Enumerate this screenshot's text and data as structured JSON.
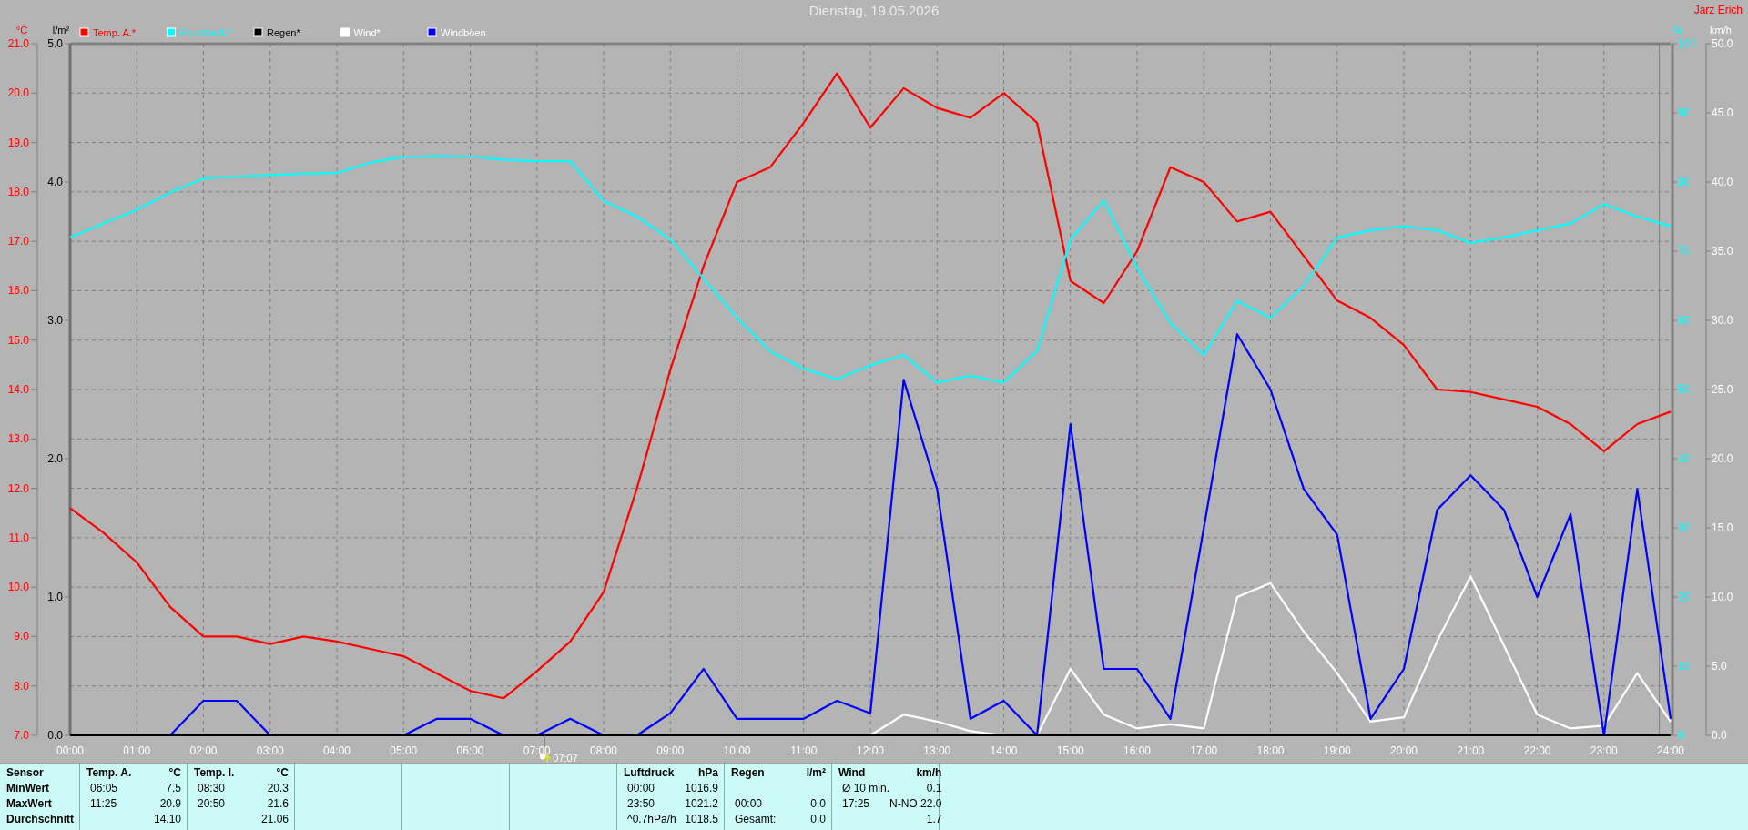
{
  "author": "Jarz Erich",
  "chart_data": {
    "type": "line",
    "title": "Dienstag, 19.05.2026",
    "x": [
      0,
      0.5,
      1,
      1.5,
      2,
      2.5,
      3,
      3.5,
      4,
      4.5,
      5,
      5.5,
      6,
      6.5,
      7,
      7.5,
      8,
      8.5,
      9,
      9.5,
      10,
      10.5,
      11,
      11.5,
      12,
      12.5,
      13,
      13.5,
      14,
      14.5,
      15,
      15.5,
      16,
      16.5,
      17,
      17.5,
      18,
      18.5,
      19,
      19.5,
      20,
      20.5,
      21,
      21.5,
      22,
      22.5,
      23,
      23.5,
      24
    ],
    "xlim": [
      0,
      24
    ],
    "xticks": [
      {
        "value": 0,
        "label": "00:00"
      },
      {
        "value": 1,
        "label": "01:00"
      },
      {
        "value": 2,
        "label": "02:00"
      },
      {
        "value": 3,
        "label": "03:00"
      },
      {
        "value": 4,
        "label": "04:00"
      },
      {
        "value": 5,
        "label": "05:00"
      },
      {
        "value": 6,
        "label": "06:00"
      },
      {
        "value": 7,
        "label": "07:00"
      },
      {
        "value": 8,
        "label": "08:00"
      },
      {
        "value": 9,
        "label": "09:00"
      },
      {
        "value": 10,
        "label": "10:00"
      },
      {
        "value": 11,
        "label": "11:00"
      },
      {
        "value": 12,
        "label": "12:00"
      },
      {
        "value": 13,
        "label": "13:00"
      },
      {
        "value": 14,
        "label": "14:00"
      },
      {
        "value": 15,
        "label": "15:00"
      },
      {
        "value": 16,
        "label": "16:00"
      },
      {
        "value": 17,
        "label": "17:00"
      },
      {
        "value": 18,
        "label": "18:00"
      },
      {
        "value": 19,
        "label": "19:00"
      },
      {
        "value": 20,
        "label": "20:00"
      },
      {
        "value": 21,
        "label": "21:00"
      },
      {
        "value": 22,
        "label": "22:00"
      },
      {
        "value": 23,
        "label": "23:00"
      },
      {
        "value": 24,
        "label": "24:00"
      }
    ],
    "ylabel": "°C",
    "ylim": [
      7,
      21
    ],
    "yticks": [
      {
        "value": 7,
        "label": "7.0"
      },
      {
        "value": 8,
        "label": "8.0"
      },
      {
        "value": 9,
        "label": "9.0"
      },
      {
        "value": 10,
        "label": "10.0"
      },
      {
        "value": 11,
        "label": "11.0"
      },
      {
        "value": 12,
        "label": "12.0"
      },
      {
        "value": 13,
        "label": "13.0"
      },
      {
        "value": 14,
        "label": "14.0"
      },
      {
        "value": 15,
        "label": "15.0"
      },
      {
        "value": 16,
        "label": "16.0"
      },
      {
        "value": 17,
        "label": "17.0"
      },
      {
        "value": 18,
        "label": "18.0"
      },
      {
        "value": 19,
        "label": "19.0"
      },
      {
        "value": 20,
        "label": "20.0"
      },
      {
        "value": 21,
        "label": "21.0"
      }
    ],
    "y2label": "%",
    "y2lim": [
      0,
      100
    ],
    "y2ticks": [
      {
        "value": 0,
        "label": "0"
      },
      {
        "value": 10,
        "label": "10"
      },
      {
        "value": 20,
        "label": "20"
      },
      {
        "value": 30,
        "label": "30"
      },
      {
        "value": 40,
        "label": "40"
      },
      {
        "value": 50,
        "label": "50"
      },
      {
        "value": 60,
        "label": "60"
      },
      {
        "value": 70,
        "label": "70"
      },
      {
        "value": 80,
        "label": "80"
      },
      {
        "value": 90,
        "label": "90"
      },
      {
        "value": 100,
        "label": "100"
      }
    ],
    "y3label": "km/h",
    "y3lim": [
      0,
      50
    ],
    "y3ticks": [
      {
        "value": 0,
        "label": "0.0"
      },
      {
        "value": 5,
        "label": "5.0"
      },
      {
        "value": 10,
        "label": "10.0"
      },
      {
        "value": 15,
        "label": "15.0"
      },
      {
        "value": 20,
        "label": "20.0"
      },
      {
        "value": 25,
        "label": "25.0"
      },
      {
        "value": 30,
        "label": "30.0"
      },
      {
        "value": 35,
        "label": "35.0"
      },
      {
        "value": 40,
        "label": "40.0"
      },
      {
        "value": 45,
        "label": "45.0"
      },
      {
        "value": 50,
        "label": "50.0"
      }
    ],
    "series": [
      {
        "name": "Temp. A.*",
        "color": "#ff0000",
        "values": [
          11.6,
          11.1,
          10.5,
          9.6,
          9.0,
          9.0,
          8.85,
          9.0,
          8.9,
          8.75,
          8.6,
          8.25,
          7.9,
          7.75,
          8.3,
          8.9,
          9.9,
          12.0,
          14.4,
          16.5,
          18.2,
          18.5,
          19.4,
          20.4,
          19.3,
          20.1,
          19.7,
          19.5,
          20.0,
          19.4,
          16.2,
          15.75,
          16.8,
          18.5,
          18.2,
          17.4,
          17.6,
          16.7,
          15.8,
          15.45,
          14.9,
          14.0,
          13.95,
          13.8,
          13.65,
          13.3,
          12.75,
          13.3,
          13.55
        ]
      },
      {
        "name": "Feuchte A.*",
        "color": "#00ffff",
        "axis": "y2",
        "values": [
          72,
          74,
          76,
          78.5,
          80.5,
          80.8,
          81,
          81.2,
          81.3,
          82.8,
          83.6,
          83.8,
          83.7,
          83.2,
          83,
          83,
          77.3,
          75,
          71.7,
          66,
          60.4,
          55.5,
          53,
          51.5,
          53.5,
          55,
          51,
          52,
          51,
          55.6,
          71.7,
          77.3,
          67.6,
          59.6,
          55,
          62.8,
          60.4,
          65,
          72,
          73,
          73.6,
          73,
          71.2,
          72,
          73,
          74,
          76.8,
          75,
          73.6
        ]
      },
      {
        "name": "Regen*",
        "color": "#000000",
        "axis": "y3",
        "values": [
          0,
          0,
          0,
          0,
          0,
          0,
          0,
          0,
          0,
          0,
          0,
          0,
          0,
          0,
          0,
          0,
          0,
          0,
          0,
          0,
          0,
          0,
          0,
          0,
          0,
          0,
          0,
          0,
          0,
          0,
          0,
          0,
          0,
          0,
          0,
          0,
          0,
          0,
          0,
          0,
          0,
          0,
          0,
          0,
          0,
          0,
          0,
          0,
          0
        ]
      },
      {
        "name": "Wind*",
        "color": "#ffffff",
        "axis": "y3",
        "values": [
          null,
          null,
          null,
          null,
          null,
          null,
          null,
          null,
          null,
          null,
          null,
          null,
          null,
          null,
          null,
          null,
          null,
          null,
          null,
          null,
          null,
          null,
          null,
          null,
          0,
          1.5,
          1.0,
          0.3,
          0,
          0,
          4.8,
          1.5,
          0.5,
          0.8,
          0.5,
          10,
          11,
          7.5,
          4.5,
          1,
          1.3,
          6.8,
          11.5,
          6.5,
          1.5,
          0.5,
          0.7,
          4.5,
          1
        ]
      },
      {
        "name": "Windböen",
        "color": "#0000ff",
        "axis": "y3",
        "values": [
          null,
          null,
          null,
          0,
          2.5,
          2.5,
          0,
          null,
          null,
          null,
          0,
          1.2,
          1.2,
          0,
          0,
          1.2,
          0,
          0,
          1.6,
          4.8,
          1.2,
          1.2,
          1.2,
          2.5,
          1.6,
          25.7,
          17.8,
          1.2,
          2.5,
          0,
          22.5,
          4.8,
          4.8,
          1.2,
          15,
          29,
          25,
          17.8,
          14.5,
          1.2,
          4.8,
          16.3,
          18.8,
          16.3,
          10,
          16,
          0,
          17.8,
          1.2
        ]
      }
    ],
    "annotations": [
      "07:07"
    ],
    "grid": true,
    "legend": "top",
    "ref_lines": [
      {
        "axis": "x",
        "value": 23.83
      }
    ]
  },
  "rain_scale": {
    "unit": "l/m²",
    "ticks": [
      "5.0",
      "4.0",
      "3.0",
      "2.0",
      "1.0",
      "0.0"
    ]
  },
  "stats": [
    {
      "kind": "labels",
      "header": "Sensor",
      "rows": [
        "MinWert",
        "MaxWert",
        "Durchschnitt"
      ]
    },
    {
      "kind": "values",
      "header": "Temp. A.",
      "unit": "°C",
      "rows": [
        {
          "time": "06:05",
          "value": "7.5"
        },
        {
          "time": "11:25",
          "value": "20.9"
        },
        {
          "value": "14.10"
        }
      ]
    },
    {
      "kind": "values",
      "header": "Temp. I.",
      "unit": "°C",
      "rows": [
        {
          "time": "08:30",
          "value": "20.3"
        },
        {
          "time": "20:50",
          "value": "21.6"
        },
        {
          "value": "21.06"
        }
      ]
    },
    {
      "kind": "blank"
    },
    {
      "kind": "blank"
    },
    {
      "kind": "blank"
    },
    {
      "kind": "values",
      "header": "Luftdruck",
      "unit": "hPa",
      "rows": [
        {
          "time": "00:00",
          "value": "1016.9"
        },
        {
          "time": "23:50",
          "value": "1021.2"
        },
        {
          "time": "^0.7hPa/h",
          "value": "1018.5"
        }
      ]
    },
    {
      "kind": "values",
      "header": "Regen",
      "unit": "l/m²",
      "rows": [
        {},
        {
          "time": "00:00",
          "value": "0.0"
        },
        {
          "time": "Gesamt:",
          "value": "0.0"
        }
      ]
    },
    {
      "kind": "values",
      "header": "Wind",
      "unit": "km/h",
      "rows": [
        {
          "time": "Ø 10 min.",
          "value": "0.1"
        },
        {
          "time": "17:25",
          "value": "N-NO 22.0"
        },
        {
          "value": "1.7"
        }
      ]
    }
  ]
}
